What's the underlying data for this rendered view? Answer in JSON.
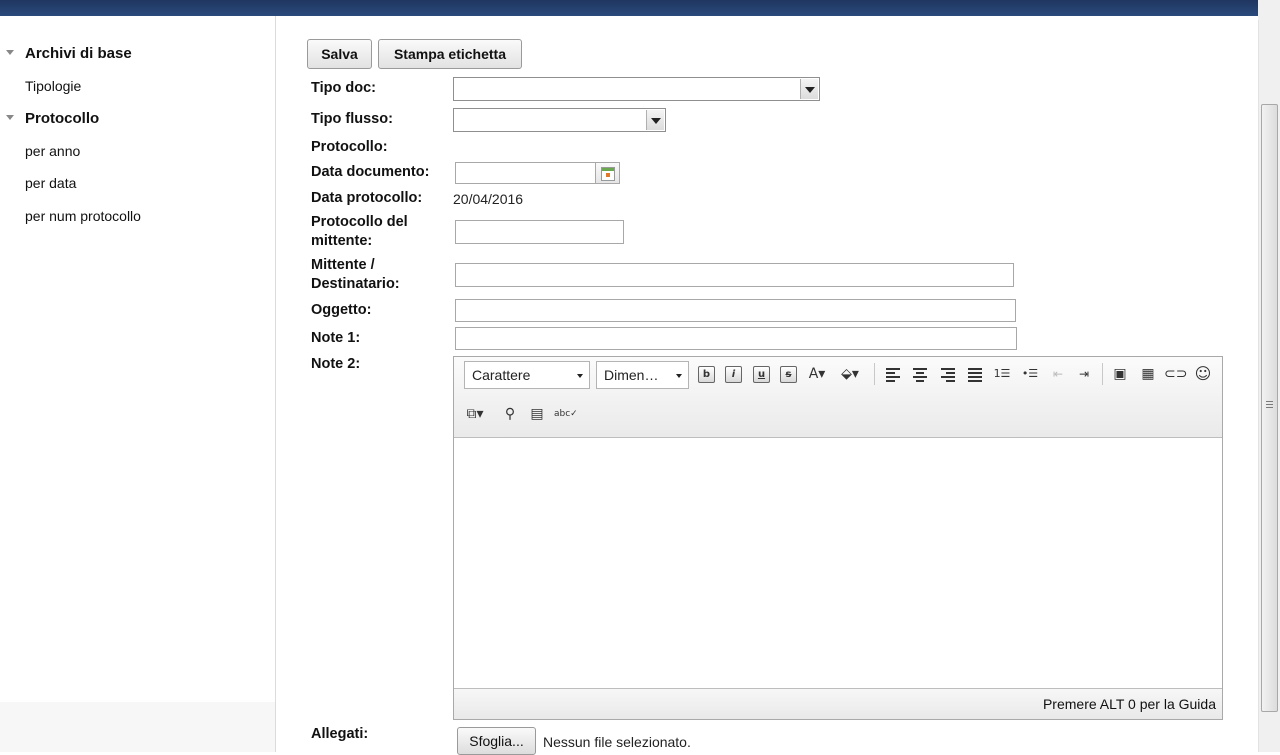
{
  "sidebar": {
    "groups": [
      {
        "label": "Archivi di base",
        "items": [
          "Tipologie"
        ]
      },
      {
        "label": "Protocollo",
        "items": [
          "per anno",
          "per data",
          "per num protocollo"
        ]
      }
    ]
  },
  "toolbar": {
    "save_label": "Salva",
    "print_label": "Stampa etichetta"
  },
  "form": {
    "tipo_doc": "Tipo doc:",
    "tipo_flusso": "Tipo flusso:",
    "protocollo": "Protocollo:",
    "data_documento": "Data documento:",
    "data_protocollo": "Data protocollo:",
    "data_protocollo_value": "20/04/2016",
    "protocollo_mittente_l1": "Protocollo del",
    "protocollo_mittente_l2": "mittente:",
    "mittente_l1": "Mittente /",
    "mittente_l2": "Destinatario:",
    "oggetto": "Oggetto:",
    "note1": "Note 1:",
    "note2": "Note 2:",
    "allegati": "Allegati:"
  },
  "editor": {
    "font_select": "Carattere",
    "size_select": "Dimen…",
    "status_hint": "Premere ALT 0 per la Guida"
  },
  "upload": {
    "browse_label": "Sfoglia...",
    "status": "Nessun file selezionato."
  },
  "colors": {
    "topbar": "#1f3660",
    "sidebar_bg": "#f7f7f7",
    "border": "#a8a8a8"
  }
}
